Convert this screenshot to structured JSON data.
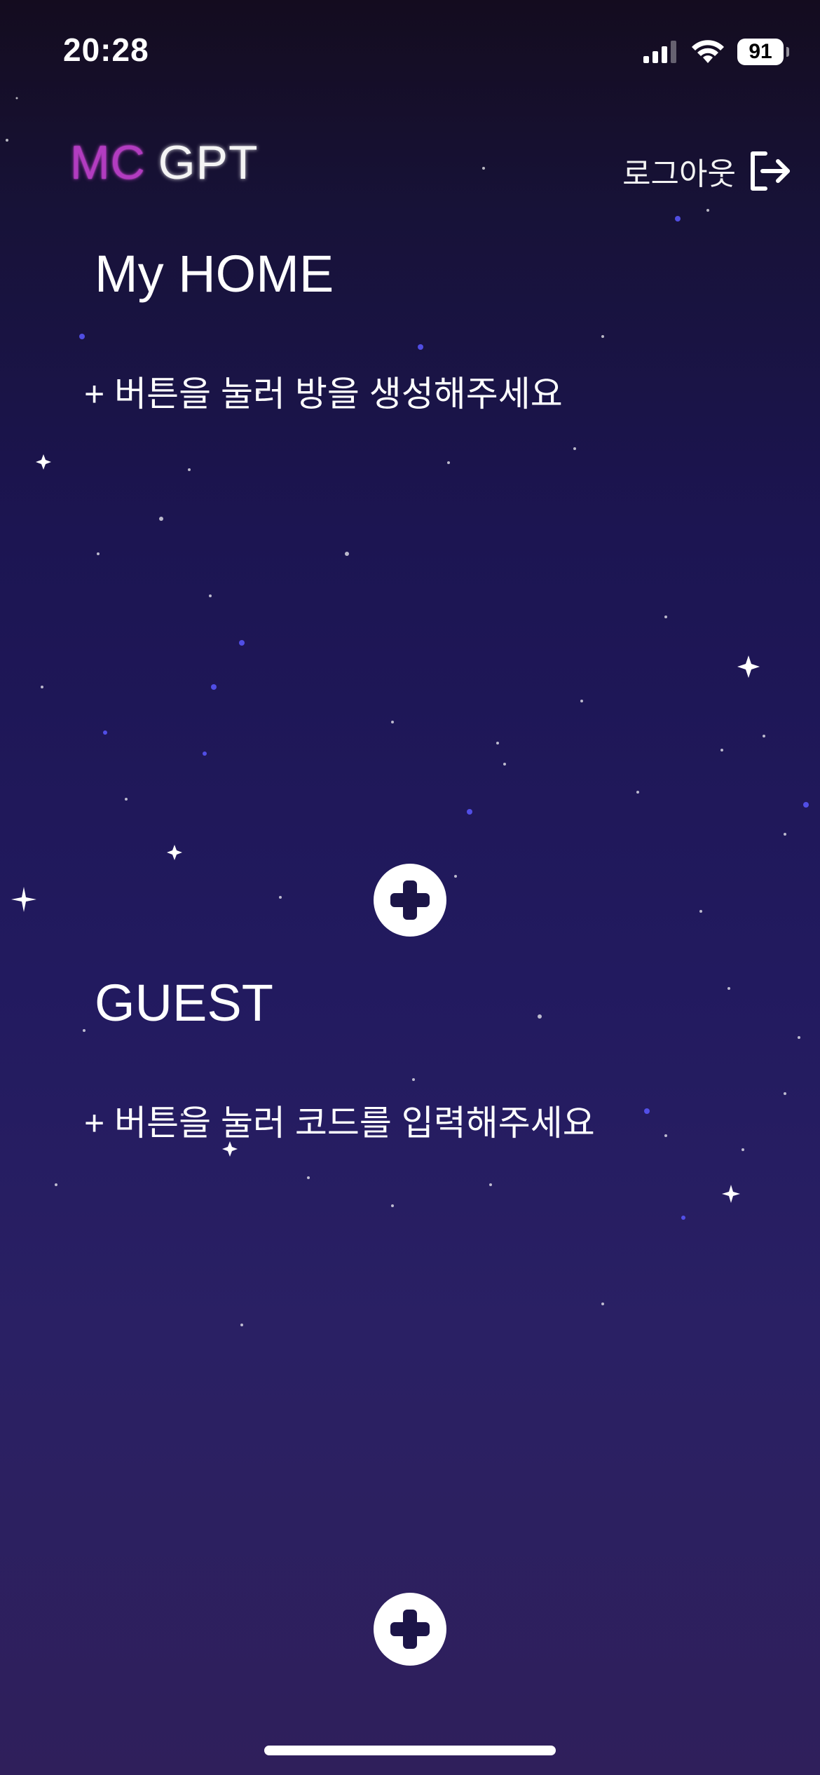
{
  "status_bar": {
    "time": "20:28",
    "battery": "91"
  },
  "header": {
    "logo_mc": "MC",
    "logo_gpt": "GPT",
    "logout_label": "로그아웃"
  },
  "home_section": {
    "title": "My HOME",
    "hint": "+ 버튼을 눌러 방을 생성해주세요"
  },
  "guest_section": {
    "title": "GUEST",
    "hint": "+ 버튼을 눌러 코드를 입력해주세요"
  },
  "colors": {
    "logo_mc": "#b23cc0",
    "button_icon": "#1c1548",
    "background_top": "#140c1f",
    "background_bottom": "#2f1f5b"
  }
}
